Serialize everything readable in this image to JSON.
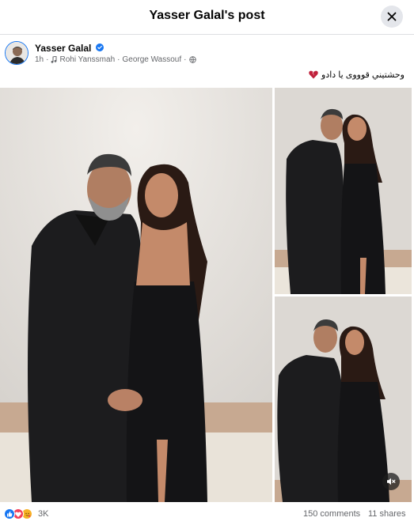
{
  "header": {
    "title": "Yasser Galal's post"
  },
  "post": {
    "author": "Yasser Galal",
    "time": "1h",
    "music_separator": "·",
    "song": "Rohi Yanssmah",
    "artist": "George Wassouf",
    "caption": "وحشتيني قوووى يا دادو",
    "caption_emoji": "broken-heart-icon"
  },
  "photos": [
    {
      "name": "photo-main"
    },
    {
      "name": "photo-top-right"
    },
    {
      "name": "photo-bottom-right"
    }
  ],
  "footer": {
    "reactions": [
      "like-reaction-icon",
      "love-reaction-icon",
      "care-reaction-icon"
    ],
    "reaction_count": "3K",
    "comments": "150 comments",
    "shares": "11 shares"
  },
  "colors": {
    "accent": "#1877f2",
    "secondary_text": "#65676b",
    "wall": "#dcd8d3",
    "baseboard": "#c7a991"
  }
}
